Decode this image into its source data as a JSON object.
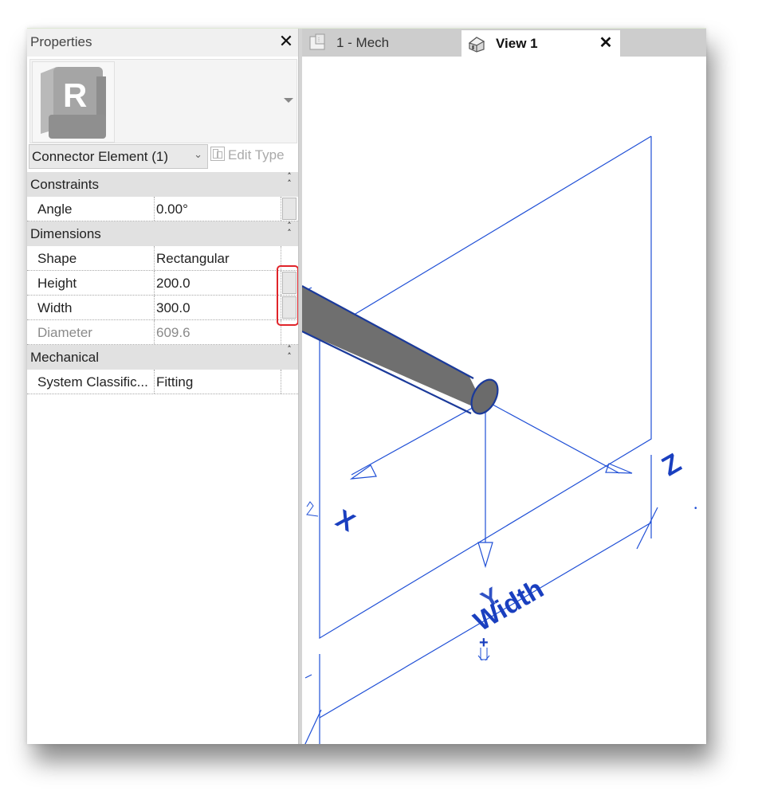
{
  "properties_panel": {
    "title": "Properties",
    "close_label": "✕",
    "type_selector": {
      "family_icon": "revit-r-logo",
      "dropdown_icon": "triangle-down"
    },
    "element_selector": {
      "value": "Connector Element (1)",
      "chevron": "⌄"
    },
    "edit_type": {
      "label": "Edit Type",
      "enabled": false
    },
    "sections": [
      {
        "label": "Constraints",
        "collapse_icon": "˄˄",
        "rows": [
          {
            "name": "Angle",
            "value": "0.00°",
            "has_associate_button": true,
            "disabled": false
          }
        ]
      },
      {
        "label": "Dimensions",
        "collapse_icon": "˄˄",
        "rows": [
          {
            "name": "Shape",
            "value": "Rectangular",
            "has_associate_button": false,
            "disabled": false
          },
          {
            "name": "Height",
            "value": "200.0",
            "has_associate_button": true,
            "disabled": false
          },
          {
            "name": "Width",
            "value": "300.0",
            "has_associate_button": true,
            "disabled": false
          },
          {
            "name": "Diameter",
            "value": "609.6",
            "has_associate_button": false,
            "disabled": true
          }
        ]
      },
      {
        "label": "Mechanical",
        "collapse_icon": "˄˄",
        "rows": [
          {
            "name": "System Classific...",
            "value": "Fitting",
            "has_associate_button": false,
            "disabled": false
          }
        ]
      }
    ],
    "highlight_color": "#e0242a"
  },
  "view_tabs": [
    {
      "label": "1 - Mech",
      "icon": "floor-plan-icon",
      "active": false
    },
    {
      "label": "View 1",
      "icon": "3d-house-icon",
      "active": true,
      "close_label": "✕"
    }
  ],
  "viewport": {
    "line_color": "#1f4fd6",
    "axis_labels": {
      "x": "X",
      "y": "Y",
      "z": "Z"
    },
    "dimension_label": "Width",
    "pipe_color": "#9a9a9a"
  }
}
